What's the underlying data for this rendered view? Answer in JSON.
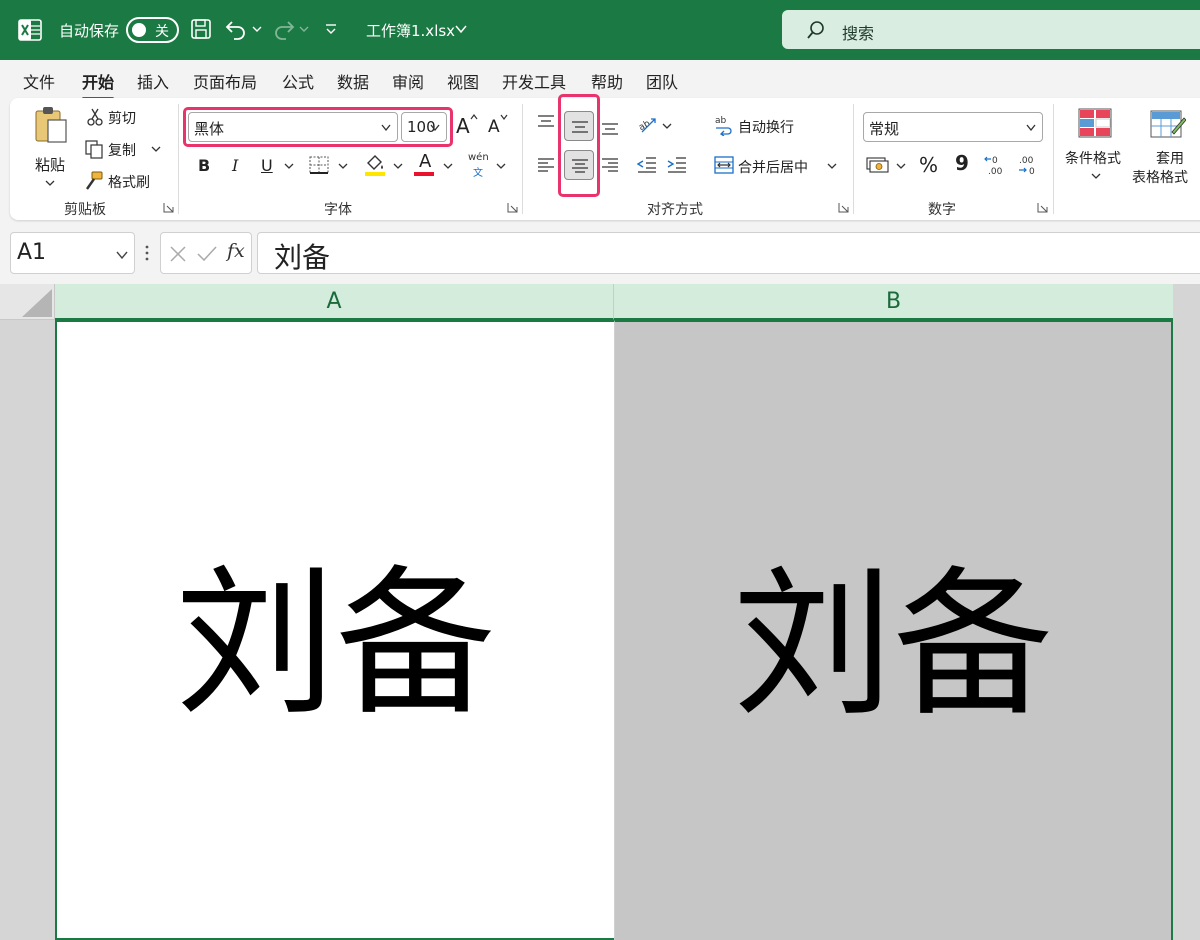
{
  "titlebar": {
    "autosave_label": "自动保存",
    "autosave_state": "关",
    "doc_title": "工作簿1.xlsx",
    "search_placeholder": "搜索",
    "accent_color": "#1b7a43"
  },
  "menu": {
    "tabs": [
      "文件",
      "开始",
      "插入",
      "页面布局",
      "公式",
      "数据",
      "审阅",
      "视图",
      "开发工具",
      "帮助",
      "团队"
    ],
    "active_index": 1
  },
  "ribbon": {
    "clipboard": {
      "paste": "粘贴",
      "cut": "剪切",
      "copy": "复制",
      "format_painter": "格式刷",
      "label": "剪贴板"
    },
    "font": {
      "name": "黑体",
      "size": "100",
      "grow": "A",
      "shrink": "A",
      "bold": "B",
      "italic": "I",
      "underline": "U",
      "color_letter": "A",
      "phonetic_top": "wén",
      "phonetic_bottom": "文",
      "label": "字体",
      "fill_color": "#ffe600",
      "font_color": "#e8122d"
    },
    "alignment": {
      "wrap_text": "自动换行",
      "merge_center": "合并后居中",
      "label": "对齐方式"
    },
    "number": {
      "format": "常规",
      "percent": "%",
      "comma": "9",
      "label": "数字"
    },
    "styles": {
      "conditional": "条件格式",
      "table_line1": "套用",
      "table_line2": "表格格式"
    },
    "highlight_color": "#e8336d"
  },
  "formula_bar": {
    "cell_ref": "A1",
    "fx": "fx",
    "value": "刘备"
  },
  "grid": {
    "columns": [
      "A",
      "B"
    ],
    "cells": {
      "A1": "刘备",
      "B1": "刘备"
    },
    "b_fill": "#c6c6c6"
  }
}
